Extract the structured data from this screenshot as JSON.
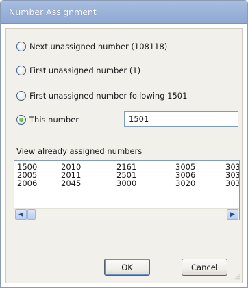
{
  "window": {
    "title": "Number Assignment"
  },
  "options": [
    {
      "label": "Next unassigned number (108118)",
      "checked": false
    },
    {
      "label": "First unassigned number (1)",
      "checked": false
    },
    {
      "label": "First unassigned number following 1501",
      "checked": false
    },
    {
      "label": "This number",
      "checked": true
    }
  ],
  "number_input": {
    "value": "1501"
  },
  "assigned": {
    "label": "View already assigned numbers",
    "columns": [
      [
        "1500",
        "2005",
        "2006"
      ],
      [
        "2010",
        "2011",
        "2045"
      ],
      [
        "2161",
        "2501",
        "3000"
      ],
      [
        "3005",
        "3006",
        "3020"
      ],
      [
        "303",
        "303",
        "303"
      ]
    ]
  },
  "buttons": {
    "ok": "OK",
    "cancel": "Cancel"
  },
  "icons": {
    "scroll_left": "scroll-left-arrow-icon",
    "scroll_right": "scroll-right-arrow-icon",
    "resize": "resize-grip-icon"
  }
}
